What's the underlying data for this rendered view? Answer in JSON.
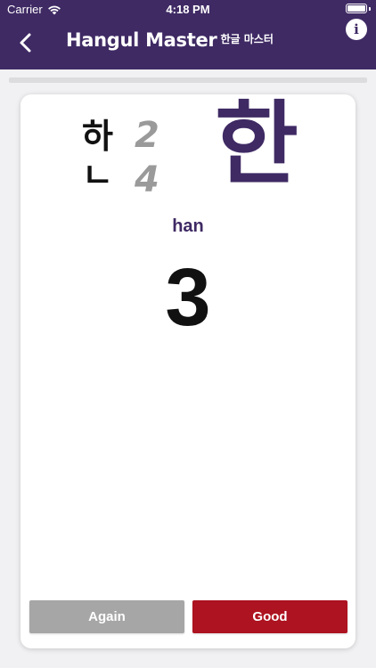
{
  "status_bar": {
    "carrier": "Carrier",
    "time": "4:18 PM"
  },
  "header": {
    "title": "Hangul Master",
    "subtitle": "한글 마스터",
    "back_icon": "chevron-left-icon",
    "info_icon": "info-icon",
    "info_glyph": "i"
  },
  "progress": {
    "fraction": 0.0
  },
  "card": {
    "jamo": [
      {
        "char": "하",
        "strokes": "2"
      },
      {
        "char": "ㄴ",
        "strokes": "4"
      }
    ],
    "syllable": "한",
    "romanization": "han",
    "answer": "3"
  },
  "actions": {
    "again_label": "Again",
    "good_label": "Good"
  },
  "colors": {
    "header_bg": "#3f2a64",
    "accent": "#3f2a64",
    "again": "#a6a6a6",
    "good": "#ad1320",
    "stroke_gray": "#9a9a9a"
  }
}
